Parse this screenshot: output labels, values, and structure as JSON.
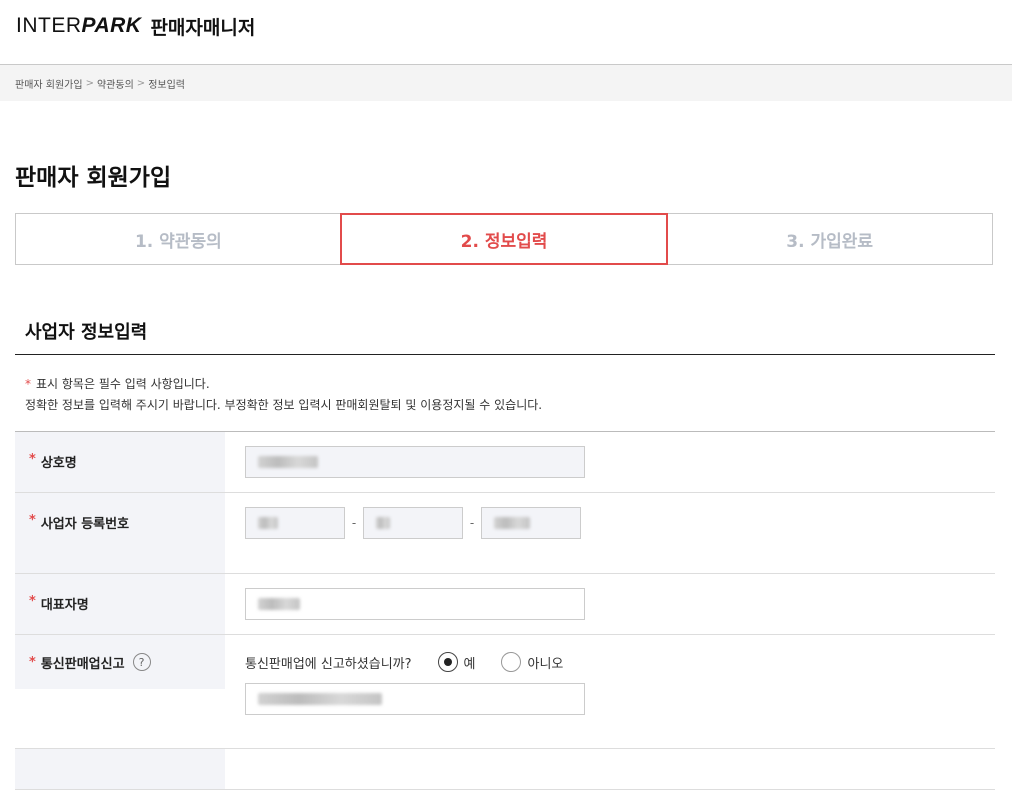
{
  "header": {
    "brand": "INTERPARK",
    "brand_part1": "INTER",
    "brand_part2": "PARK",
    "subtitle": "판매자매니저"
  },
  "breadcrumb": [
    "판매자 회원가입",
    "약관동의",
    "정보입력"
  ],
  "page_title": "판매자 회원가입",
  "steps": [
    {
      "label": "1. 약관동의",
      "active": false
    },
    {
      "label": "2. 정보입력",
      "active": true
    },
    {
      "label": "3. 가입완료",
      "active": false
    }
  ],
  "section_title": "사업자 정보입력",
  "notice": {
    "line1": "표시 항목은 필수 입력 사항입니다.",
    "line2": "정확한 정보를 입력해 주시기 바랍니다. 부정확한 정보 입력시 판매회원탈퇴 및 이용정지될 수 있습니다."
  },
  "form": {
    "company_name": {
      "label": "상호명"
    },
    "business_number": {
      "label": "사업자 등록번호",
      "separator": "-"
    },
    "representative": {
      "label": "대표자명"
    },
    "mail_order": {
      "label": "통신판매업신고",
      "help": "?",
      "question": "통신판매업에 신고하셨습니까?",
      "options": [
        "예",
        "아니오"
      ],
      "selected": "예"
    }
  },
  "colors": {
    "accent": "#e24b4b",
    "inactive_step": "#b6bcc6",
    "label_bg": "#f3f4f8"
  }
}
